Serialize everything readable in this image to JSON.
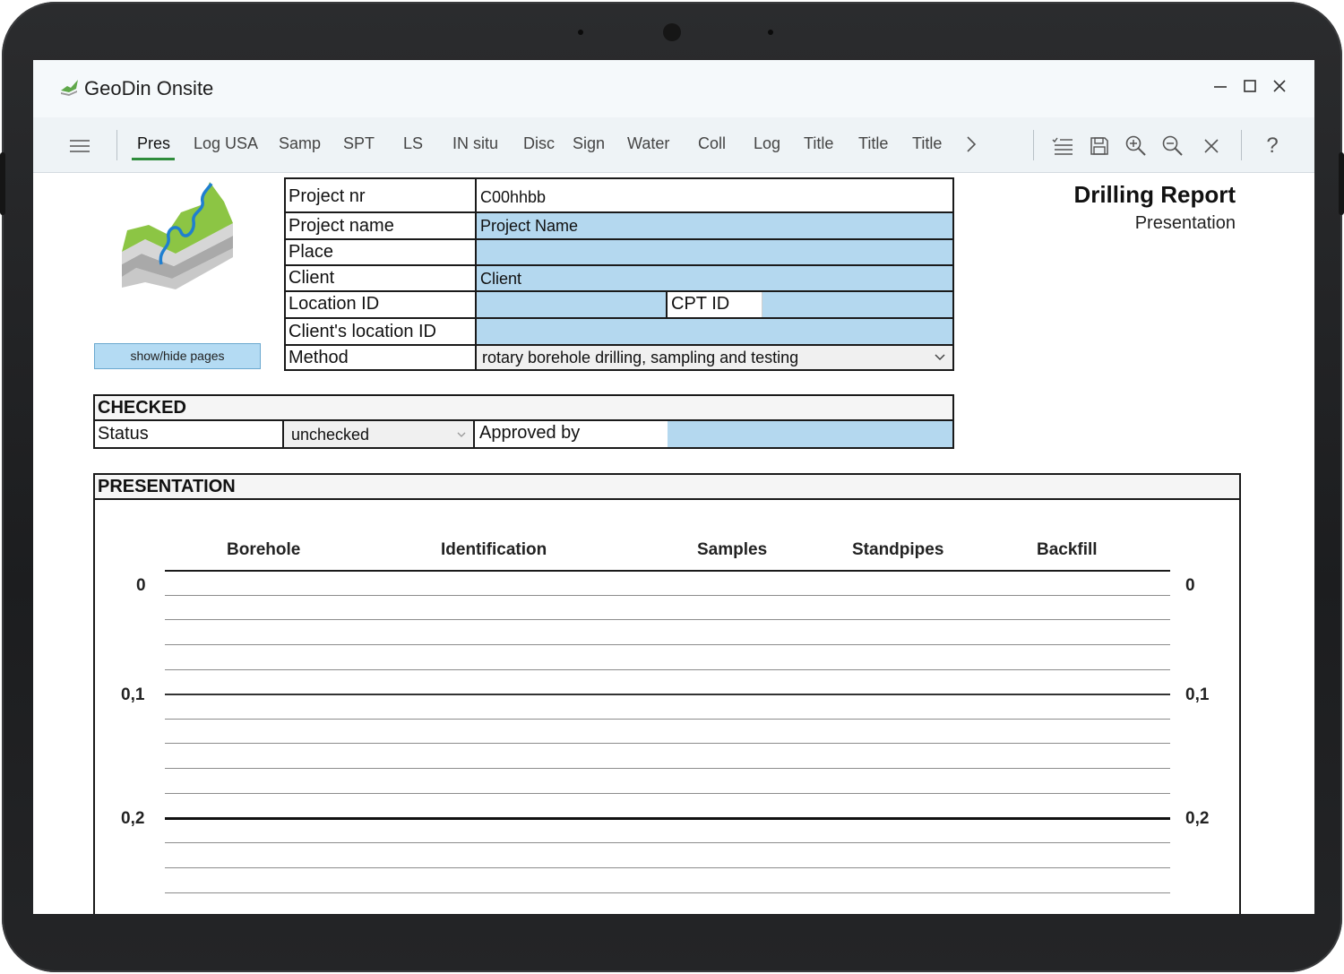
{
  "app": {
    "title": "GeoDin Onsite"
  },
  "window_controls": {
    "minimize": "—",
    "maximize": "☐",
    "close": "✕"
  },
  "toolbar": {
    "tabs": [
      "Pres",
      "Log USA",
      "Samp",
      "SPT",
      "LS",
      "IN situ",
      "Disc",
      "Sign",
      "Water",
      "Coll",
      "Log",
      "Title",
      "Title",
      "Title"
    ],
    "active_tab": "Pres",
    "more": "›",
    "help": "?"
  },
  "sidebar": {
    "show_hide_label": "show/hide pages"
  },
  "header": {
    "title": "Drilling Report",
    "subtitle": "Presentation"
  },
  "project": {
    "project_nr_label": "Project nr",
    "project_nr_value": "C00hhbb",
    "project_name_label": "Project name",
    "project_name_value": "Project Name",
    "place_label": "Place",
    "place_value": "",
    "client_label": "Client",
    "client_value": "Client",
    "location_id_label": "Location ID",
    "location_id_value": "",
    "cpt_id_label": "CPT ID",
    "cpt_id_value": "",
    "clients_location_id_label": "Client's location ID",
    "clients_location_id_value": "",
    "method_label": "Method",
    "method_value": "rotary borehole drilling, sampling and testing"
  },
  "checked": {
    "heading": "CHECKED",
    "status_label": "Status",
    "status_value": "unchecked",
    "approved_by_label": "Approved by",
    "approved_by_value": ""
  },
  "presentation": {
    "heading": "PRESENTATION",
    "columns": [
      "Borehole",
      "Identification",
      "Samples",
      "Standpipes",
      "Backfill"
    ],
    "depths": [
      "0",
      "0,1",
      "0,2"
    ]
  },
  "colors": {
    "accent": "#2f8c3c",
    "field_blue": "#b4d8ef",
    "button_blue": "#b4dbf3"
  }
}
